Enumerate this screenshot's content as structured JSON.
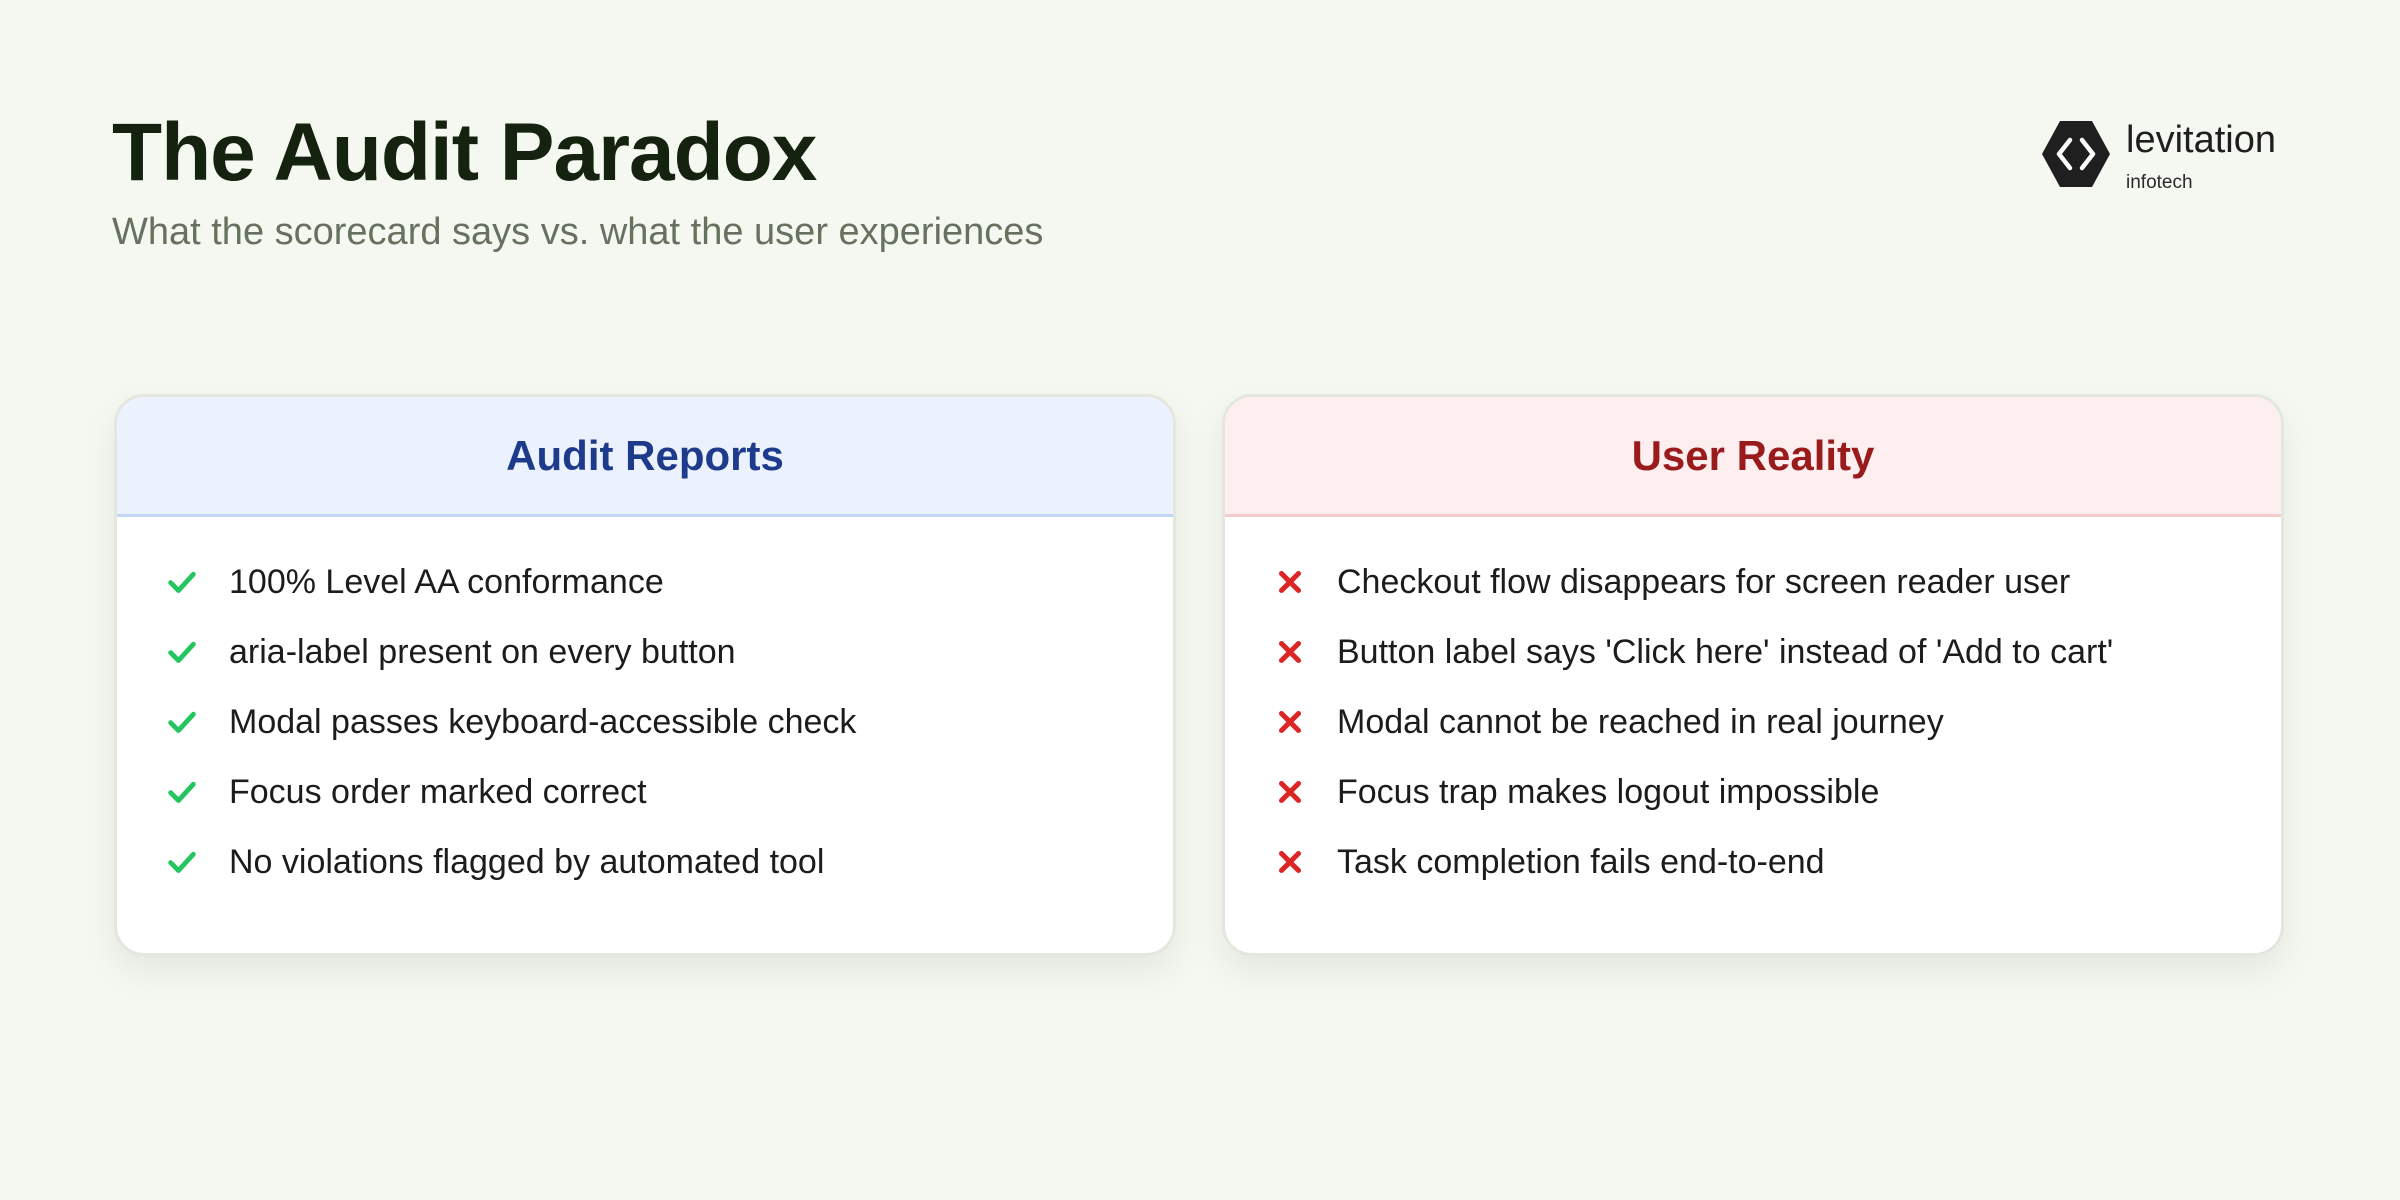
{
  "header": {
    "title": "The Audit Paradox",
    "subtitle": "What the scorecard says vs. what the user experiences"
  },
  "logo": {
    "name": "levitation",
    "sub": "infotech",
    "icon": "hexagon-code-brackets-icon"
  },
  "colors": {
    "background": "#f5f8f1",
    "title": "#14220f",
    "audit_accent": "#1e3a8a",
    "audit_header_bg": "#ebf2fd",
    "user_accent": "#991b1b",
    "user_header_bg": "#fdefef",
    "check": "#22c55e",
    "cross": "#dc2626"
  },
  "cards": {
    "audit": {
      "title": "Audit Reports",
      "icon": "check-icon",
      "items": [
        "100% Level AA conformance",
        "aria-label present on every button",
        "Modal passes keyboard-accessible check",
        "Focus order marked correct",
        "No violations flagged by automated tool"
      ]
    },
    "user": {
      "title": "User Reality",
      "icon": "cross-icon",
      "items": [
        "Checkout flow disappears for screen reader user",
        "Button label says 'Click here' instead of 'Add to cart'",
        "Modal cannot be reached in real journey",
        "Focus trap makes logout impossible",
        "Task completion fails end-to-end"
      ]
    }
  }
}
